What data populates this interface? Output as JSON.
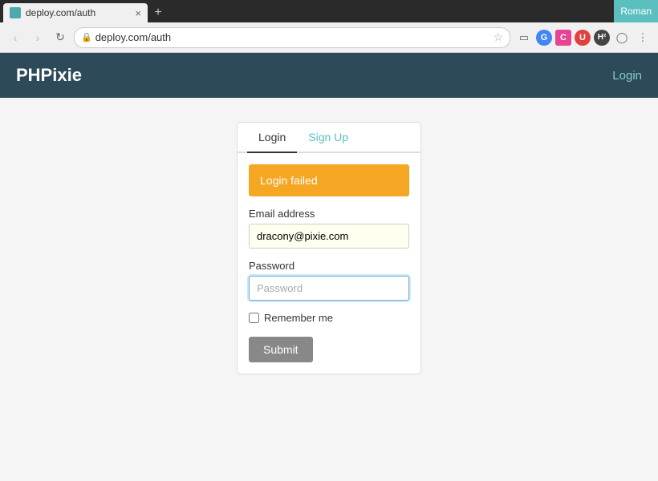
{
  "browser": {
    "tab_title": "deploy.com/auth",
    "tab_close": "×",
    "url": "deploy.com/auth",
    "new_tab_label": "+",
    "user_name": "Roman",
    "nav": {
      "back_symbol": "‹",
      "forward_symbol": "›",
      "refresh_symbol": "↻"
    }
  },
  "app": {
    "logo": "PHPixie",
    "header_login": "Login"
  },
  "auth": {
    "tabs": [
      {
        "label": "Login",
        "active": true
      },
      {
        "label": "Sign Up",
        "active": false
      }
    ],
    "alert": {
      "message": "Login failed"
    },
    "email_label": "Email address",
    "email_value": "dracony@pixie.com",
    "email_placeholder": "",
    "password_label": "Password",
    "password_placeholder": "Password",
    "remember_label": "Remember me",
    "submit_label": "Submit"
  }
}
